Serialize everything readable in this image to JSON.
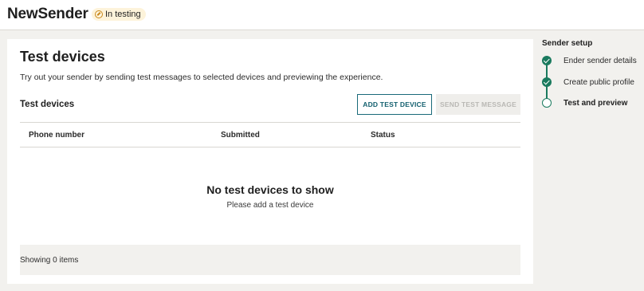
{
  "header": {
    "app_name": "NewSender",
    "status_badge": "In testing"
  },
  "main": {
    "title": "Test devices",
    "description": "Try out your sender by sending test messages to selected devices and previewing the experience.",
    "section_title": "Test devices",
    "add_button": "ADD TEST DEVICE",
    "send_button": "SEND TEST MESSAGE",
    "table": {
      "columns": [
        "Phone number",
        "Submitted",
        "Status"
      ],
      "rows": []
    },
    "empty_state": {
      "title": "No test devices to show",
      "subtitle": "Please add a test device"
    },
    "footer": "Showing 0 items"
  },
  "sidebar": {
    "title": "Sender setup",
    "steps": [
      {
        "label": "Ender sender details",
        "state": "done"
      },
      {
        "label": "Create public profile",
        "state": "done"
      },
      {
        "label": "Test and preview",
        "state": "current"
      }
    ]
  },
  "colors": {
    "accent": "#1a7a5e",
    "primary_button": "#14606f",
    "badge_bg": "#fdf3da"
  }
}
